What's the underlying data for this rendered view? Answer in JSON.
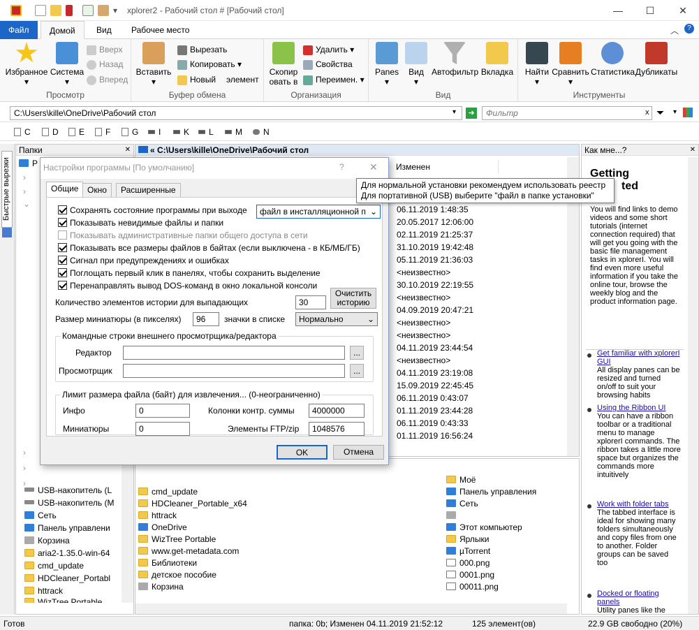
{
  "window": {
    "title": "xplorer2 - Рабочий стол # [Рабочий стол]"
  },
  "menu_tabs": [
    "Файл",
    "Домой",
    "Вид",
    "Рабочее место"
  ],
  "ribbon": {
    "prosmotr": {
      "label": "Просмотр",
      "favorites": "Избранное",
      "system": "Система",
      "up": "Вверх",
      "back": "Назад",
      "forward": "Вперед"
    },
    "clipboard": {
      "label": "Буфер обмена",
      "paste": "Вставить",
      "cut": "Вырезать",
      "copy": "Копировать",
      "new": "Новый",
      "element": "элемент"
    },
    "organize": {
      "label": "Организация",
      "copyto": "Скопир",
      "copyto2": "овать в",
      "delete": "Удалить",
      "props": "Свойства",
      "rename": "Переимен."
    },
    "view": {
      "label": "Вид",
      "panes": "Panes",
      "view": "Вид",
      "autofilter": "Автофильтр",
      "tab": "Вкладка"
    },
    "tools": {
      "label": "Инструменты",
      "find": "Найти",
      "compare": "Сравнить",
      "stats": "Статистика",
      "dups": "Дубликаты"
    }
  },
  "address": {
    "path": "C:\\Users\\kille\\OneDrive\\Рабочий стол",
    "filter_placeholder": "Фильтр"
  },
  "drives": [
    "C",
    "D",
    "E",
    "F",
    "G",
    "I",
    "K",
    "L",
    "M",
    "N"
  ],
  "left_pane": {
    "title": "Папки",
    "side_tab": "Быстрые вырезки",
    "items": [
      "USB-накопитель (L",
      "USB-накопитель (M",
      "Сеть",
      "Панель управлени",
      "Корзина",
      "aria2-1.35.0-win-64",
      "cmd_update",
      "HDCleaner_Portabl",
      "httrack",
      "WizTree Portable"
    ]
  },
  "main_pane": {
    "path": "« C:\\Users\\kille\\OneDrive\\Рабочий стол",
    "col_modified": "Изменен",
    "dates": [
      "06.11.2019 1:48:35",
      "20.05.2017 12:06:00",
      "02.11.2019 21:25:37",
      "31.10.2019 19:42:48",
      "05.11.2019 21:36:03",
      "<неизвестно>",
      "30.10.2019 22:19:55",
      "<неизвестно>",
      "04.09.2019 20:47:21",
      "<неизвестно>",
      "<неизвестно>",
      "04.11.2019 23:44:54",
      "<неизвестно>",
      "04.11.2019 23:19:08",
      "15.09.2019 22:45:45",
      "06.11.2019 0:43:07",
      "01.11.2019 23:44:28",
      "06.11.2019 0:43:33",
      "01.11.2019 16:56:24"
    ]
  },
  "bottom_pane": {
    "col1": [
      "cmd_update",
      "HDCleaner_Portable_x64",
      "httrack",
      "OneDrive",
      "WizTree Portable",
      "www.get-metadata.com",
      "Библиотеки",
      "детское пособие",
      "Корзина"
    ],
    "col2": [
      "Моё",
      "Панель управления",
      "Сеть",
      "",
      "Этот компьютер",
      "Ярлыки",
      "µTorrent",
      "000.png",
      "0001.png",
      "00011.png"
    ]
  },
  "help": {
    "title": "Как мне...?",
    "heading1": "Getting",
    "heading2": "ted",
    "intro": "You will find links to demo videos and some short tutorials (internet connection required) that will get you going with the basic file management tasks in xplorerI. You will find even more useful information if you take the online tour, browse the weekly blog and the product information page.",
    "l1": "Get familiar with xplorerI GUI",
    "t1": "All display panes can be resized and turned on/off to suit your browsing habits",
    "l2": "Using the Ribbon UI",
    "t2": "You can have a ribbon toolbar or a traditional menu to manage xplorerI commands. The ribbon takes a little more space but organizes the commands more intuitively",
    "l3": "Work with folder tabs",
    "t3": "The tabbed interface is ideal for showing many folders simultaneously and copy files from one to another. Folder groups can be saved too",
    "l4": "Docked or floating panels",
    "t4": "Utility panes like the"
  },
  "status": {
    "left": "Готов",
    "mid": "папка: 0b; Изменен 04.11.2019 21:52:12",
    "count": "125 элемент(ов)",
    "free": "22.9 GB свободно (20%)"
  },
  "tooltip": {
    "line1": "Для нормальной установки рекомендуем использовать реестр",
    "line2": "Для портативной (USB) выберите \"файл в папке установки\""
  },
  "dialog": {
    "title": "Настройки программы [По умолчанию]",
    "help": "?",
    "tabs": [
      "Общие",
      "Окно",
      "Расширенные"
    ],
    "checks": [
      {
        "label": "Сохранять состояние программы при выходе",
        "on": true,
        "dis": false
      },
      {
        "label": "Показывать невидимые файлы и папки",
        "on": true,
        "dis": false
      },
      {
        "label": "Показывать административные папки общего доступа в сети",
        "on": false,
        "dis": true
      },
      {
        "label": "Показывать все размеры файлов в байтах (если выключена - в КБ/МБ/ГБ)",
        "on": true,
        "dis": false
      },
      {
        "label": "Сигнал при предупреждениях и ошибках",
        "on": true,
        "dis": false
      },
      {
        "label": "Поглощать первый клик в панелях, чтобы сохранить выделение",
        "on": true,
        "dis": false
      },
      {
        "label": "Перенаправлять вывод DOS-команд в окно локальной консоли",
        "on": true,
        "dis": false
      }
    ],
    "save_select": "файл в инсталляционной п",
    "history_label": "Количество элементов истории для выпадающих",
    "history_value": "30",
    "clear_history": "Очистить историю",
    "thumb_label": "Размер миниатюры (в пикселях)",
    "thumb_value": "96",
    "icons_label": "значки в списке",
    "icons_select": "Нормально",
    "ext_group": "Командные строки внешнего просмотрщика/редактора",
    "editor": "Редактор",
    "viewer": "Просмотрщик",
    "browse": "...",
    "limit_group": "Лимит размера файла (байт) для извлечения... (0-неограниченно)",
    "info": "Инфо",
    "info_val": "0",
    "thumbs": "Миниатюры",
    "thumbs_val": "0",
    "checksum": "Колонки контр. суммы",
    "checksum_val": "4000000",
    "ftp": "Элементы FTP/zip",
    "ftp_val": "1048576",
    "ok": "OK",
    "cancel": "Отмена"
  },
  "colors": {
    "accent": "#1b66c8",
    "selection": "#cde8ff"
  }
}
